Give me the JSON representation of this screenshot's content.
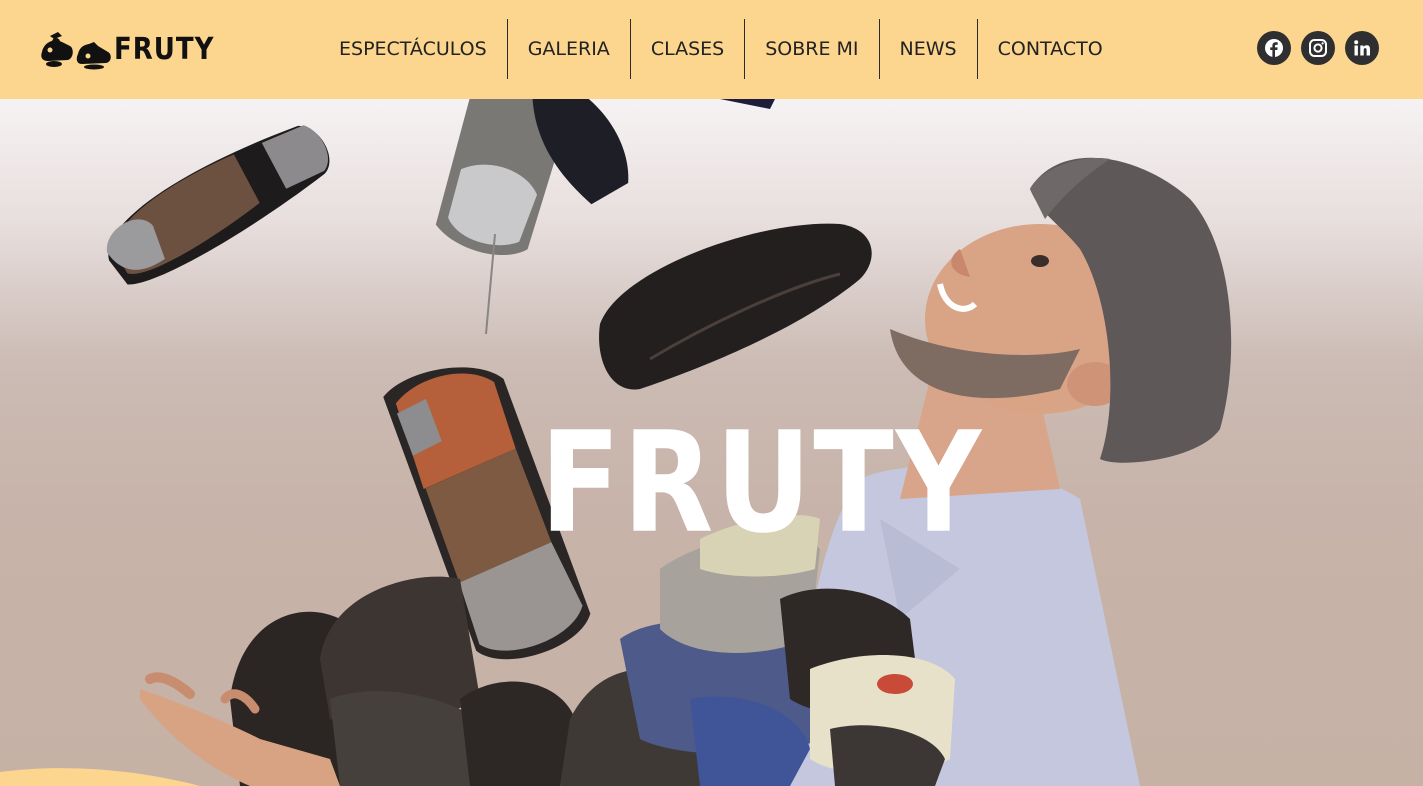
{
  "brand": {
    "name": "FRUTY",
    "logo_icon": "tap-shoes-logo-icon"
  },
  "nav": {
    "items": [
      {
        "label": "ESPECTÁCULOS"
      },
      {
        "label": "GALERIA"
      },
      {
        "label": "CLASES"
      },
      {
        "label": "SOBRE MI"
      },
      {
        "label": "NEWS"
      },
      {
        "label": "CONTACTO"
      }
    ]
  },
  "social": {
    "items": [
      {
        "icon": "facebook-icon"
      },
      {
        "icon": "instagram-icon"
      },
      {
        "icon": "linkedin-icon"
      }
    ]
  },
  "hero": {
    "title": "FRUTY",
    "image_description_icon": "juggling-tap-shoes-photo"
  },
  "colors": {
    "header_bg": "#fcd58e",
    "social_bg": "#2f2f31",
    "title": "#ffffff"
  }
}
